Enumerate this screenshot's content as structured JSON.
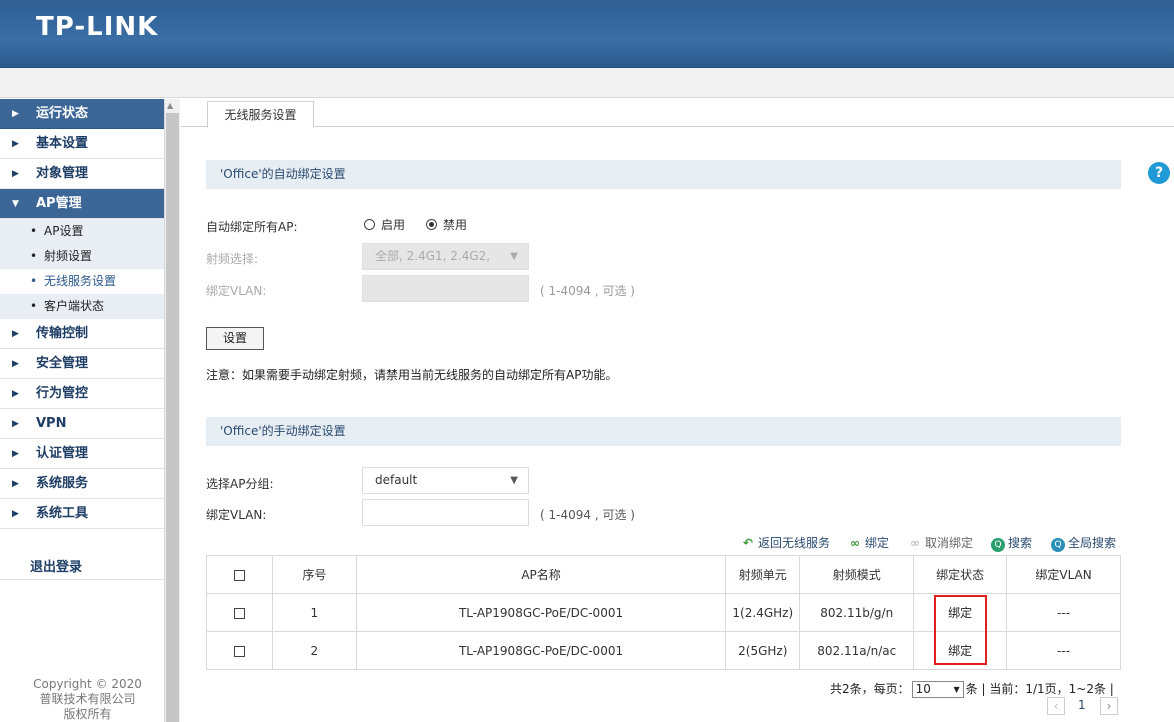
{
  "header": {
    "logo": "TP-LINK"
  },
  "sidebar": {
    "items": [
      {
        "label": "运行状态"
      },
      {
        "label": "基本设置"
      },
      {
        "label": "对象管理"
      },
      {
        "label": "AP管理"
      },
      {
        "label": "传输控制"
      },
      {
        "label": "安全管理"
      },
      {
        "label": "行为管控"
      },
      {
        "label": "VPN"
      },
      {
        "label": "认证管理"
      },
      {
        "label": "系统服务"
      },
      {
        "label": "系统工具"
      }
    ],
    "subitems": [
      {
        "label": "AP设置"
      },
      {
        "label": "射频设置"
      },
      {
        "label": "无线服务设置"
      },
      {
        "label": "客户端状态"
      }
    ],
    "logout": "退出登录",
    "copyright_line1": "Copyright © 2020",
    "copyright_line2": "普联技术有限公司",
    "copyright_line3": "版权所有"
  },
  "tabs": {
    "active": "无线服务设置"
  },
  "auto_bind": {
    "title": "'Office'的自动绑定设置",
    "bind_all_label": "自动绑定所有AP:",
    "opt_enable": "启用",
    "opt_disable": "禁用",
    "selected": "禁用",
    "freq_label": "射频选择:",
    "freq_value": "全部, 2.4G1, 2.4G2,",
    "vlan_label": "绑定VLAN:",
    "vlan_hint": "( 1-4094 , 可选 )",
    "set_button": "设置",
    "note": "注意：如果需要手动绑定射频，请禁用当前无线服务的自动绑定所有AP功能。"
  },
  "manual_bind": {
    "title": "'Office'的手动绑定设置",
    "group_label": "选择AP分组:",
    "group_value": "default",
    "vlan_label": "绑定VLAN:",
    "vlan_hint": "( 1-4094 , 可选 )"
  },
  "toolbar": {
    "back": "返回无线服务",
    "bind": "绑定",
    "unbind": "取消绑定",
    "search": "搜索",
    "global_search": "全局搜索"
  },
  "table": {
    "headers": [
      "序号",
      "AP名称",
      "射频单元",
      "射频模式",
      "绑定状态",
      "绑定VLAN"
    ],
    "rows": [
      {
        "index": "1",
        "name": "TL-AP1908GC-PoE/DC-0001",
        "unit": "1(2.4GHz)",
        "mode": "802.11b/g/n",
        "status": "绑定",
        "vlan": "---"
      },
      {
        "index": "2",
        "name": "TL-AP1908GC-PoE/DC-0001",
        "unit": "2(5GHz)",
        "mode": "802.11a/n/ac",
        "status": "绑定",
        "vlan": "---"
      }
    ]
  },
  "pager": {
    "total": "共2条，每页：",
    "per_page": "10",
    "info": "条 | 当前：1/1页，1~2条 |",
    "page": "1"
  },
  "colors": {
    "header": "#3a6ea5",
    "accent": "#3c6696",
    "highlight": "#e02020"
  }
}
